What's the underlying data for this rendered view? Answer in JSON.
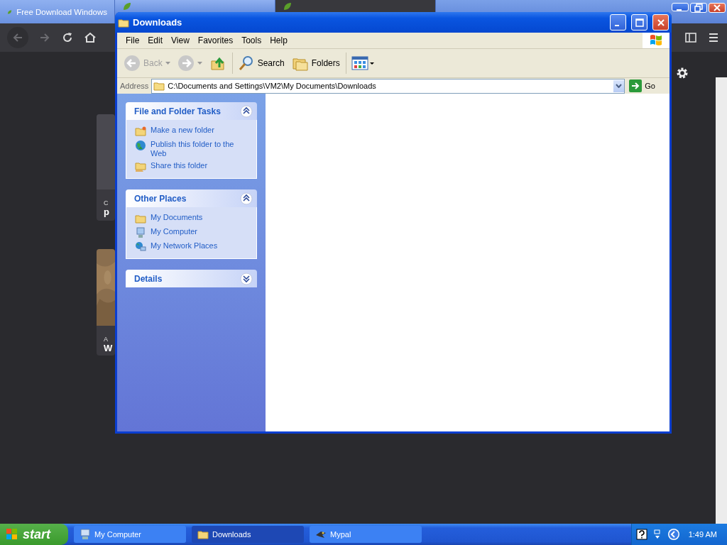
{
  "browser": {
    "tabs": [
      {
        "label": "Free Download Windows",
        "selected": false
      },
      {
        "selected": false
      },
      {
        "selected": true
      }
    ],
    "cards": [
      {
        "kind": "blank",
        "caption": "C",
        "title": "p"
      },
      {
        "kind": "picture",
        "caption": "A",
        "title": "W"
      }
    ]
  },
  "window": {
    "title": "Downloads",
    "menu": [
      "File",
      "Edit",
      "View",
      "Favorites",
      "Tools",
      "Help"
    ],
    "toolbar": [
      {
        "kind": "back",
        "label": "Back",
        "disabled": true
      },
      {
        "kind": "forward",
        "disabled": true
      },
      {
        "kind": "up"
      },
      {
        "kind": "search",
        "label": "Search"
      },
      {
        "kind": "folders",
        "label": "Folders"
      },
      {
        "kind": "views"
      }
    ],
    "address": {
      "label": "Address",
      "value": "C:\\Documents and Settings\\VM2\\My Documents\\Downloads",
      "go": "Go"
    },
    "panels": [
      {
        "title": "File and Folder Tasks",
        "expanded": true,
        "items": [
          {
            "kind": "new-folder",
            "label": "Make a new folder"
          },
          {
            "kind": "globe",
            "label": "Publish this folder to the Web"
          },
          {
            "kind": "share",
            "label": "Share this folder"
          }
        ]
      },
      {
        "title": "Other Places",
        "expanded": true,
        "items": [
          {
            "kind": "folder",
            "label": "My Documents"
          },
          {
            "kind": "computer",
            "label": "My Computer"
          },
          {
            "kind": "network",
            "label": "My Network Places"
          }
        ]
      },
      {
        "title": "Details",
        "expanded": false
      }
    ]
  },
  "taskbar": {
    "start": "start",
    "buttons": [
      {
        "kind": "computer",
        "label": "My Computer",
        "selected": false
      },
      {
        "kind": "folder",
        "label": "Downloads",
        "selected": true
      },
      {
        "kind": "app",
        "label": "Mypal",
        "selected": false
      }
    ],
    "clock": "1:49 AM"
  }
}
